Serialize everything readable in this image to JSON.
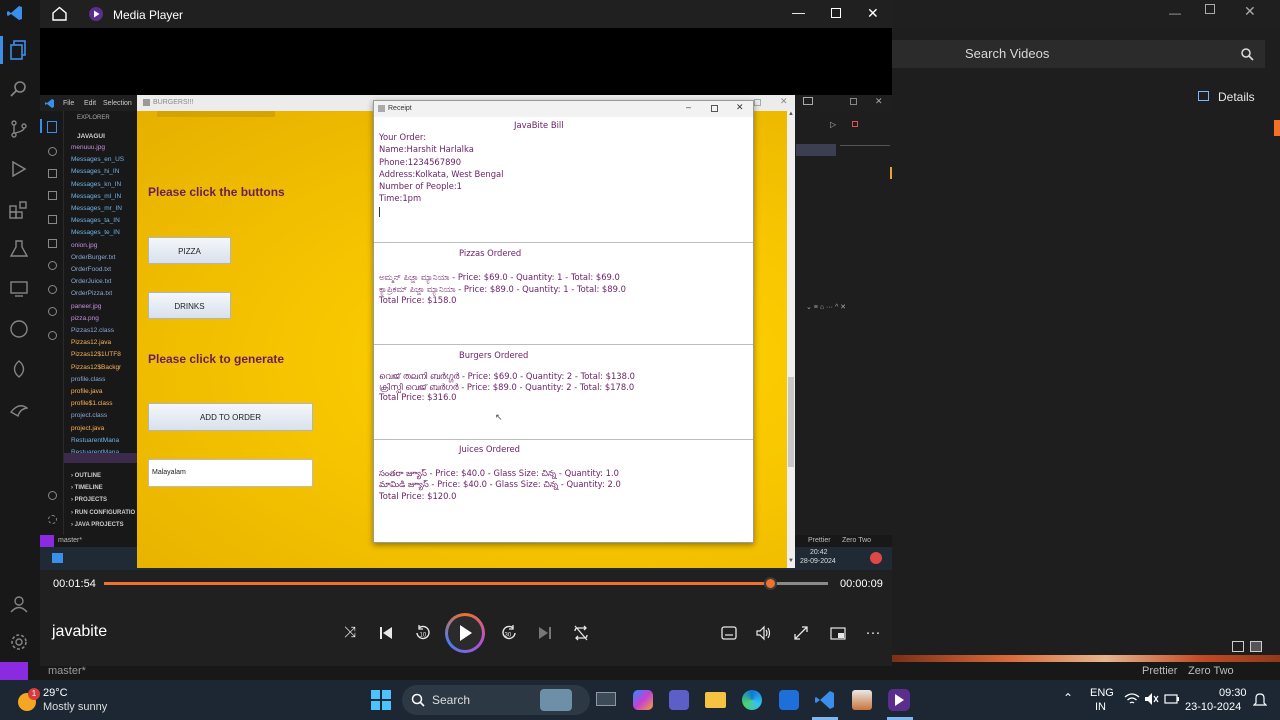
{
  "player": {
    "title": "Media Player",
    "video_name": "javabite",
    "time_elapsed": "00:01:54",
    "time_remaining": "00:00:09",
    "progress_fraction": 0.92
  },
  "background": {
    "search_placeholder": "Search Videos",
    "details_label": "Details",
    "status_branch": "master*",
    "status_right": [
      "Prettier",
      "Zero Two"
    ]
  },
  "recorded": {
    "vscode_menu": [
      "File",
      "Edit",
      "Selection"
    ],
    "explorer_header": "EXPLORER",
    "project_name": "JAVAGUI",
    "explorer_files": [
      "menuuu.jpg",
      "Messages_en_US",
      "Messages_hi_IN",
      "Messages_kn_IN",
      "Messages_ml_IN",
      "Messages_mr_IN",
      "Messages_ta_IN",
      "Messages_te_IN",
      "onion.jpg",
      "OrderBurger.txt",
      "OrderFood.txt",
      "OrderJuice.txt",
      "OrderPizza.txt",
      "paneer.jpg",
      "pizza.png",
      "Pizzas12.class",
      "Pizzas12.java",
      "Pizzas12$1UTF8",
      "Pizzas12$Backgr",
      "profile.class",
      "profile.java",
      "profile$1.class",
      "project.class",
      "project.java",
      "RestuarentMana",
      "RestuarentMana"
    ],
    "explorer_sections": [
      "OUTLINE",
      "TIMELINE",
      "PROJECTS",
      "RUN CONFIGURATIO",
      "JAVA PROJECTS"
    ],
    "status_branch": "master*",
    "status_right": [
      "Prettier",
      "Zero Two"
    ],
    "clock_time": "20:42",
    "clock_date": "28-09-2024",
    "app": {
      "window_title": "BURGERS!!!",
      "prompt_buttons": "Please click the buttons",
      "pizza_label": "PIZZA",
      "drinks_label": "DRINKS",
      "prompt_generate": "Please click to generate",
      "add_to_order_label": "ADD TO ORDER",
      "language_value": "Malayalam"
    },
    "receipt": {
      "window_title": "Receipt",
      "header": {
        "title": "JavaBite Bill",
        "lines": [
          "Your Order:",
          "Name:Harshit Harlalka",
          "Phone:1234567890",
          "Address:Kolkata, West Bengal",
          "Number of People:1",
          "Time:1pm"
        ]
      },
      "pizzas": {
        "title": "Pizzas Ordered",
        "lines": [
          "ಅಮ್ಮನ್ ಪಿಜ್ಜಾ ಮ್ಯಾನಿಯಾ - Price: $69.0 - Quantity: 1 - Total: $69.0",
          " ಕ್ಯಾಪ್ರಿಕಮ್ ಪಿಜ್ಜಾ ಮ್ಯಾನಿಯಾ - Price: $89.0 - Quantity: 1 - Total: $89.0",
          "Total Price: $158.0"
        ]
      },
      "burgers": {
        "title": "Burgers Ordered",
        "lines": [
          "വെജ് തലനി ബർഗ്ഗർ - Price: $69.0 - Quantity: 2 - Total: $138.0",
          " ക്രിസ്പി വെജ് ബർഗർ - Price: $89.0 - Quantity: 2 - Total: $178.0",
          "Total Price: $316.0"
        ]
      },
      "juices": {
        "title": "Juices Ordered",
        "lines": [
          "సంతరా జ్యూస్ - Price: $40.0 - Glass Size: చిన్న - Quantity: 1.0",
          " మామిడి జ్యూస్ - Price: $40.0 - Glass Size: చిన్న - Quantity: 2.0",
          "Total Price: $120.0"
        ]
      }
    }
  },
  "taskbar": {
    "weather_temp": "29°C",
    "weather_desc": "Mostly sunny",
    "weather_badge": "1",
    "search_label": "Search",
    "lang_line1": "ENG",
    "lang_line2": "IN",
    "time": "09:30",
    "date": "23-10-2024"
  },
  "colors": {
    "accent_orange": "#f0712c",
    "vscode_blue": "#3b8eea",
    "receipt_text": "#6b1e66",
    "app_yellow": "#f7c500"
  }
}
